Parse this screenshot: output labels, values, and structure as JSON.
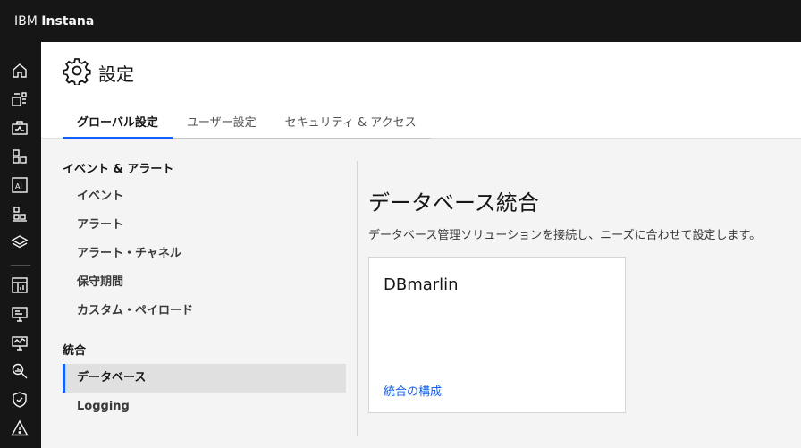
{
  "app": {
    "brand_ibm": "IBM",
    "brand_product": "Instana"
  },
  "rail": {
    "icons": [
      "home-icon",
      "applications-icon",
      "infrastructure-icon",
      "services-icon",
      "ai-icon",
      "platforms-icon",
      "layers-icon",
      "dashboard-icon",
      "websites-icon",
      "synthetic-monitoring-icon",
      "analytics-icon",
      "security-shield-icon",
      "alert-warning-icon"
    ]
  },
  "header": {
    "title": "設定"
  },
  "tabs": [
    {
      "label": "グローバル設定",
      "active": true
    },
    {
      "label": "ユーザー設定",
      "active": false
    },
    {
      "label": "セキュリティ & アクセス",
      "active": false
    }
  ],
  "nav": {
    "sections": [
      {
        "heading": "イベント & アラート",
        "items": [
          "イベント",
          "アラート",
          "アラート・チャネル",
          "保守期間",
          "カスタム・ペイロード"
        ]
      },
      {
        "heading": "統合",
        "items": [
          "データベース",
          "Logging"
        ]
      }
    ],
    "selected": "データベース"
  },
  "content": {
    "title": "データベース統合",
    "description": "データベース管理ソリューションを接続し、ニーズに合わせて設定します。",
    "tile": {
      "title": "DBmarlin",
      "link": "統合の構成"
    }
  },
  "colors": {
    "topbar": "#161616",
    "accent": "#0f62fe",
    "background": "#f4f4f4",
    "selected_bg": "#e0e0e0"
  }
}
